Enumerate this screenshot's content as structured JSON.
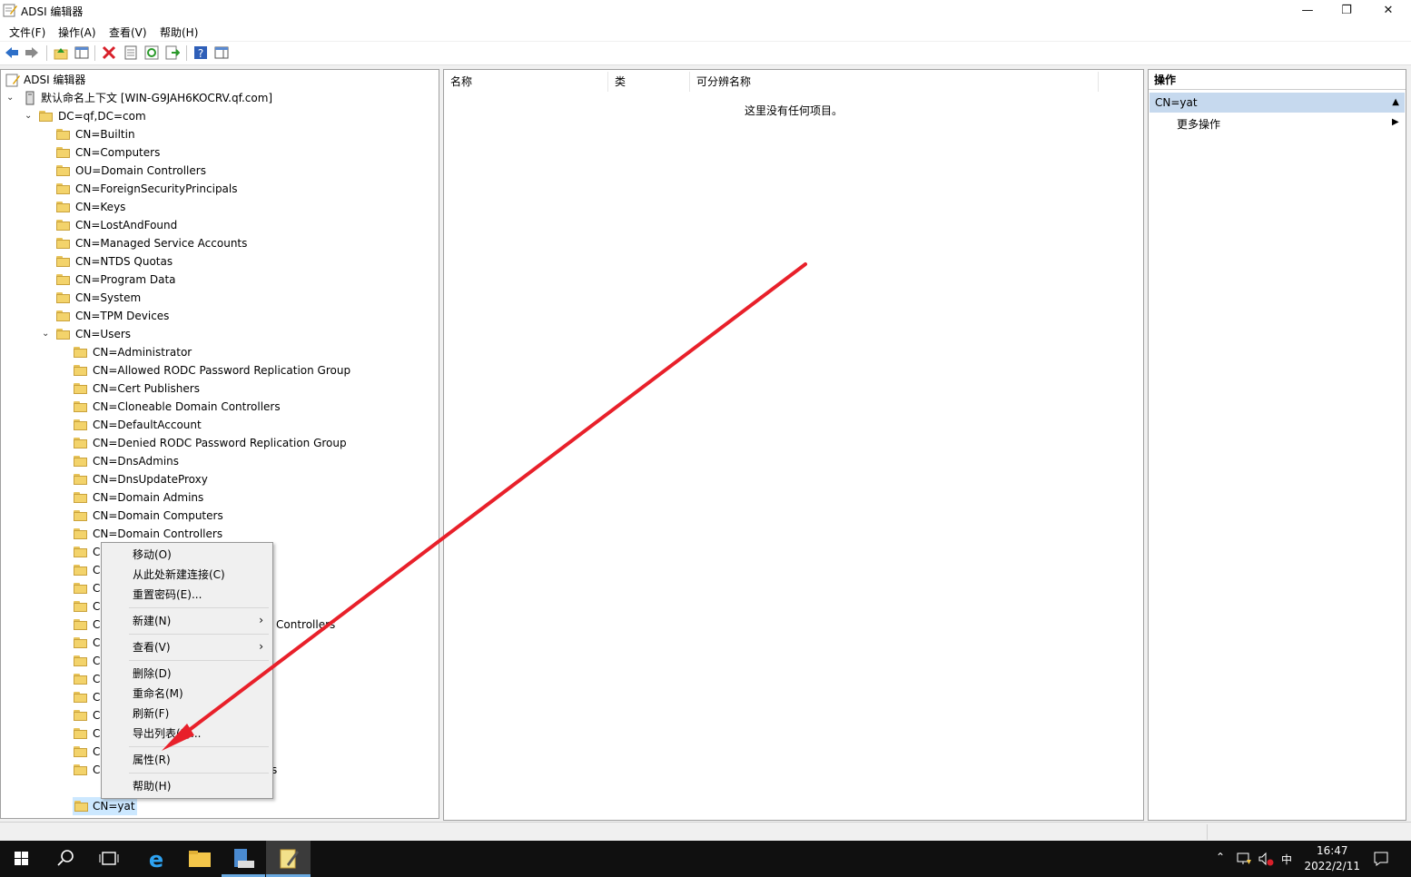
{
  "window": {
    "title": "ADSI 编辑器",
    "minimize_label": "—",
    "restore_label": "❐",
    "close_label": "✕"
  },
  "menu": {
    "items": [
      "文件(F)",
      "操作(A)",
      "查看(V)",
      "帮助(H)"
    ]
  },
  "toolbar": {
    "icons": [
      "back-icon",
      "forward-icon",
      "up-folder-icon",
      "show-hide-tree-icon",
      "delete-icon",
      "properties-icon",
      "refresh-icon",
      "export-icon",
      "help-icon",
      "show-action-pane-icon"
    ]
  },
  "tree": {
    "root": "ADSI 编辑器",
    "context": "默认命名上下文 [WIN-G9JAH6KOCRV.qf.com]",
    "domain": "DC=qf,DC=com",
    "domain_children": [
      "CN=Builtin",
      "CN=Computers",
      "OU=Domain Controllers",
      "CN=ForeignSecurityPrincipals",
      "CN=Keys",
      "CN=LostAndFound",
      "CN=Managed Service Accounts",
      "CN=NTDS Quotas",
      "CN=Program Data",
      "CN=System",
      "CN=TPM Devices"
    ],
    "users_node": "CN=Users",
    "users_children": [
      "CN=Administrator",
      "CN=Allowed RODC Password Replication Group",
      "CN=Cert Publishers",
      "CN=Cloneable Domain Controllers",
      "CN=DefaultAccount",
      "CN=Denied RODC Password Replication Group",
      "CN=DnsAdmins",
      "CN=DnsUpdateProxy",
      "CN=Domain Admins",
      "CN=Domain Computers",
      "CN=Domain Controllers"
    ],
    "hidden_rows_prefix": [
      "C",
      "C",
      "C",
      "C",
      "C",
      "C",
      "C",
      "C",
      "C",
      "C",
      "C",
      "C",
      "C"
    ],
    "partial_texts": [
      "Controllers",
      "s"
    ],
    "selected_item": "CN=yat"
  },
  "list": {
    "columns": [
      "名称",
      "类",
      "可分辨名称"
    ],
    "empty_message": "这里没有任何项目。"
  },
  "actions": {
    "header": "操作",
    "section": "CN=yat",
    "items": [
      "更多操作"
    ]
  },
  "context_menu": {
    "items": [
      {
        "label": "移动(O)"
      },
      {
        "label": "从此处新建连接(C)"
      },
      {
        "label": "重置密码(E)..."
      },
      {
        "label": "新建(N)",
        "submenu": true
      },
      {
        "label": "查看(V)",
        "submenu": true
      },
      {
        "label": "删除(D)"
      },
      {
        "label": "重命名(M)"
      },
      {
        "label": "刷新(F)"
      },
      {
        "label": "导出列表(L)..."
      },
      {
        "label": "属性(R)"
      },
      {
        "label": "帮助(H)"
      }
    ]
  },
  "annotation": {
    "arrow_color": "#e8202a"
  },
  "taskbar": {
    "time": "16:47",
    "date": "2022/2/11",
    "ime": "中"
  }
}
